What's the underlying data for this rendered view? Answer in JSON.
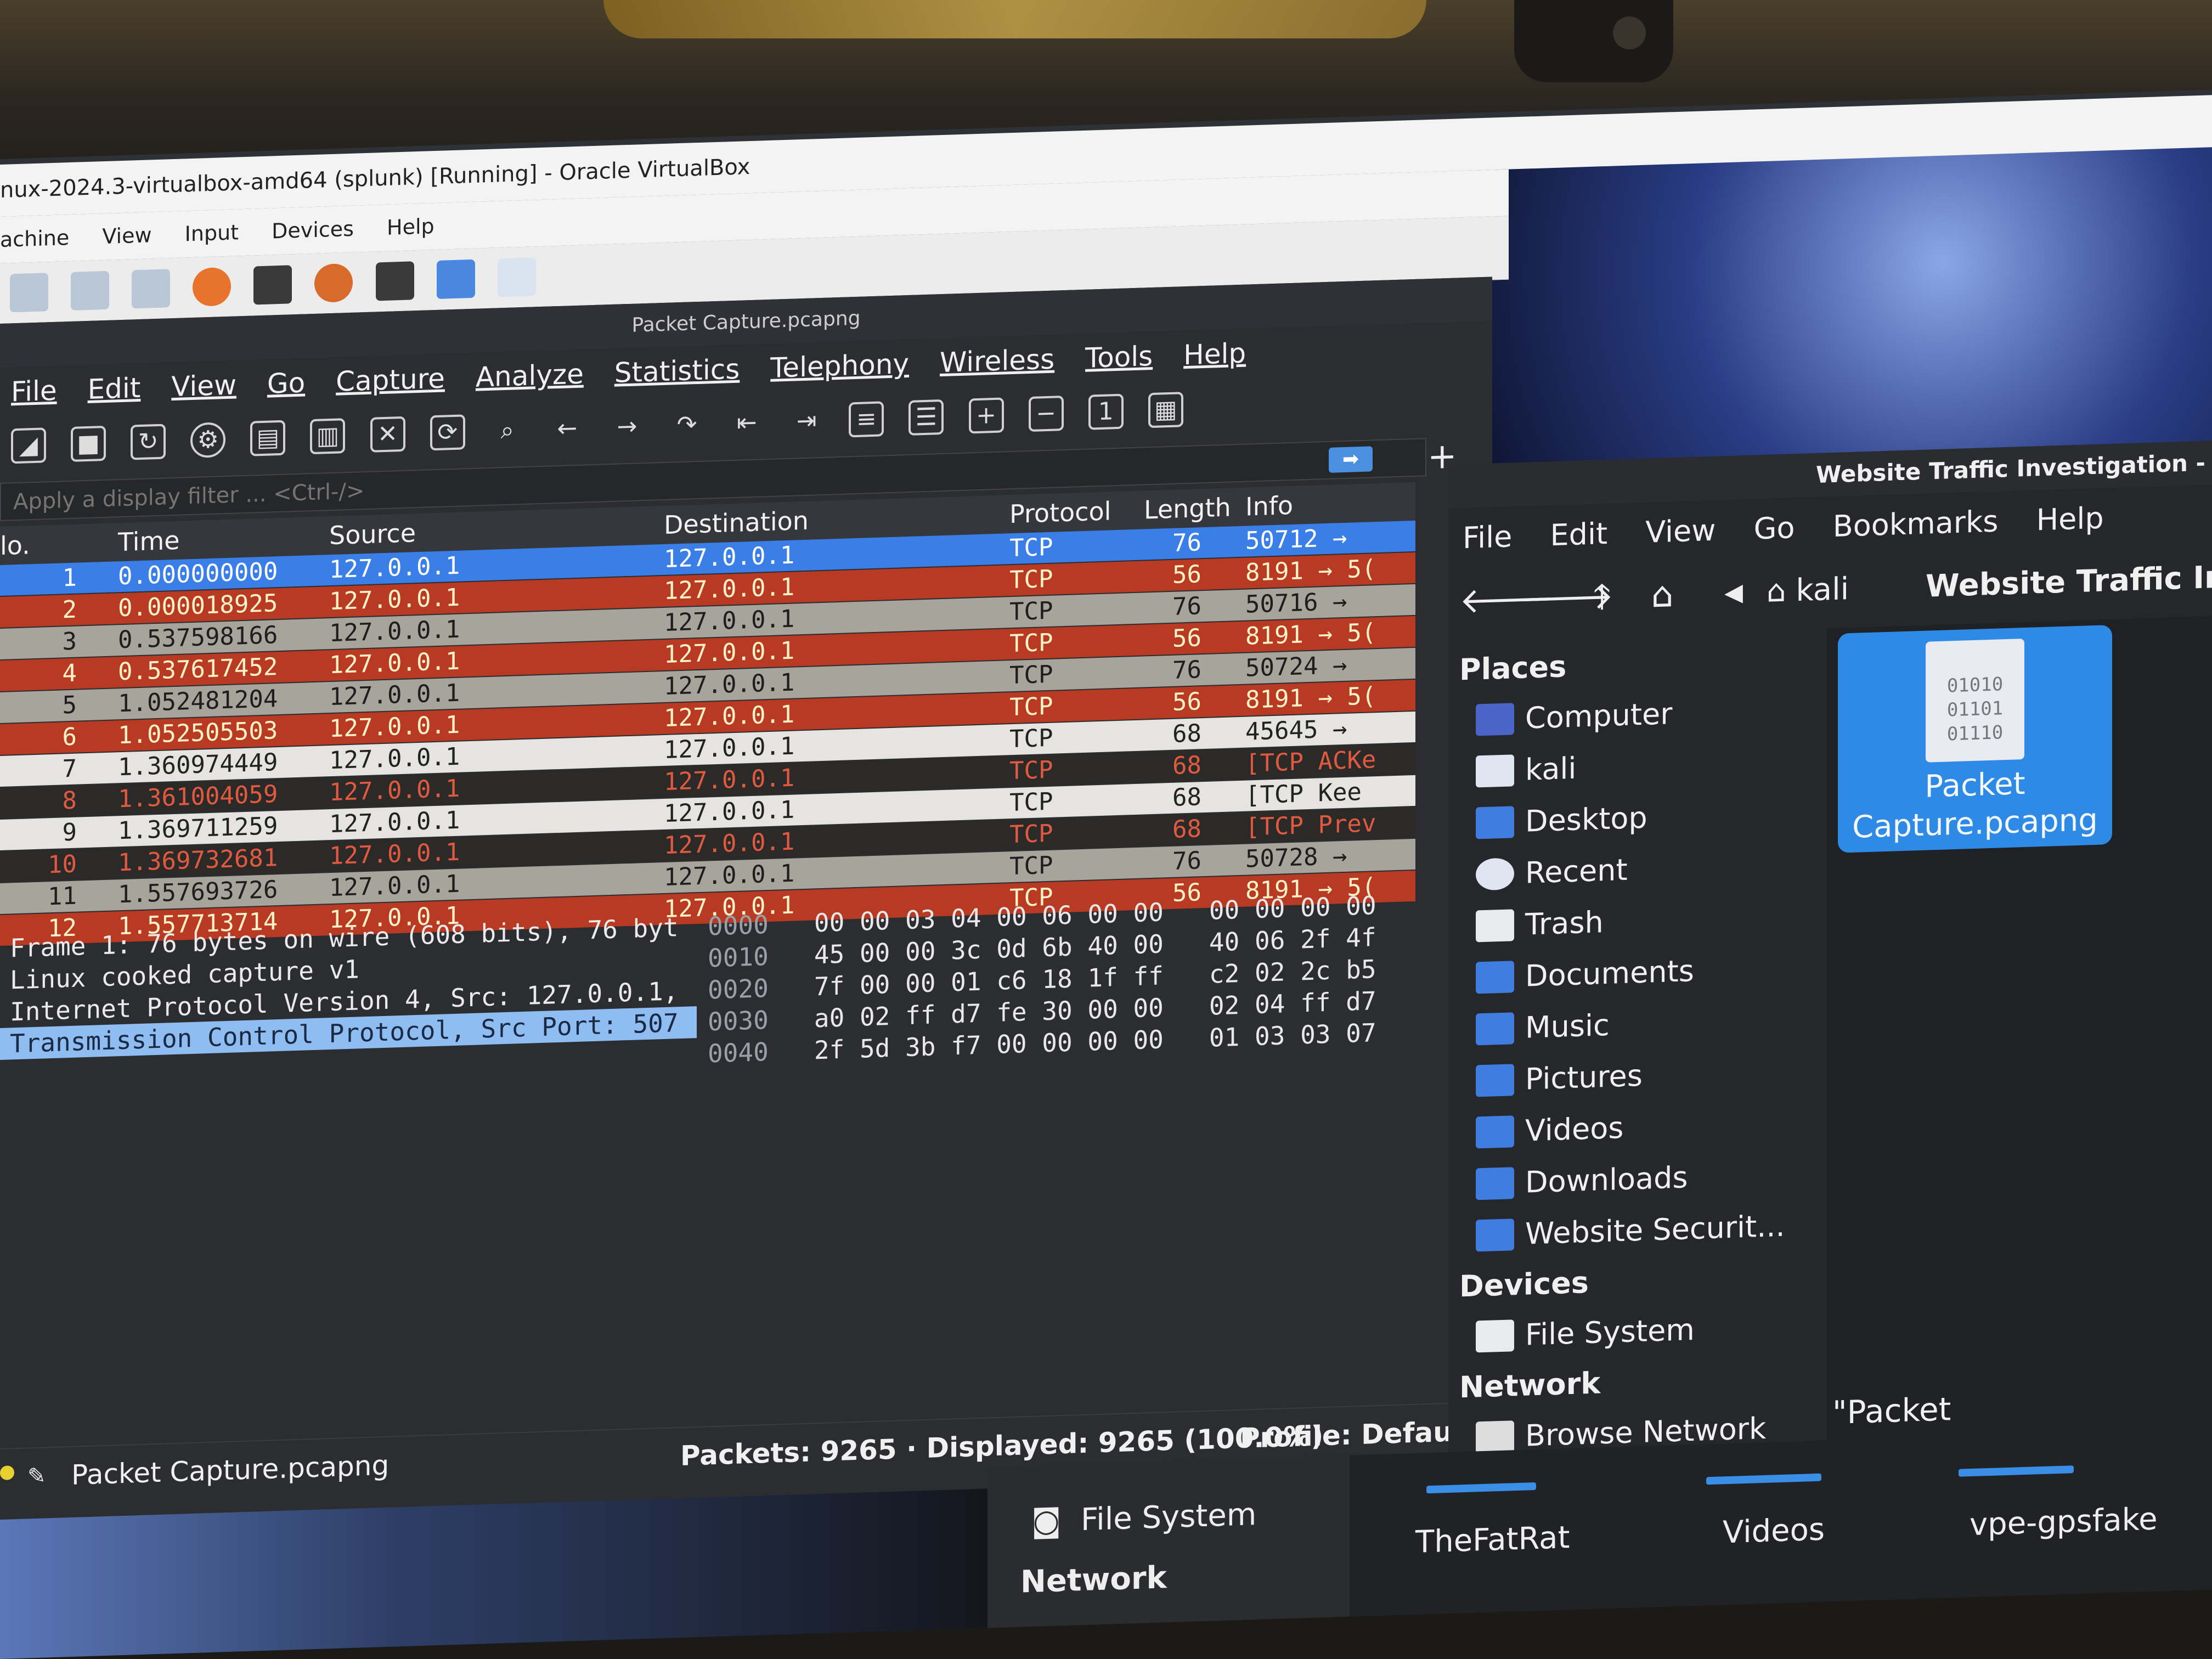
{
  "virtualbox": {
    "title": "nux-2024.3-virtualbox-amd64 (splunk) [Running] - Oracle VirtualBox",
    "menu": [
      "achine",
      "View",
      "Input",
      "Devices",
      "Help"
    ]
  },
  "wireshark": {
    "title": "Packet Capture.pcapng",
    "menu": [
      "File",
      "Edit",
      "View",
      "Go",
      "Capture",
      "Analyze",
      "Statistics",
      "Telephony",
      "Wireless",
      "Tools",
      "Help"
    ],
    "filter_placeholder": "Apply a display filter ... <Ctrl-/>",
    "columns": {
      "no": "lo.",
      "time": "Time",
      "source": "Source",
      "destination": "Destination",
      "protocol": "Protocol",
      "length": "Length",
      "info": "Info"
    },
    "packets": [
      {
        "no": "1",
        "time": "0.000000000",
        "source": "127.0.0.1",
        "destination": "127.0.0.1",
        "protocol": "TCP",
        "length": "76",
        "info": "50712 →",
        "style": "selected"
      },
      {
        "no": "2",
        "time": "0.000018925",
        "source": "127.0.0.1",
        "destination": "127.0.0.1",
        "protocol": "TCP",
        "length": "56",
        "info": "8191 → 5(",
        "style": "red"
      },
      {
        "no": "3",
        "time": "0.537598166",
        "source": "127.0.0.1",
        "destination": "127.0.0.1",
        "protocol": "TCP",
        "length": "76",
        "info": "50716 →",
        "style": "gray"
      },
      {
        "no": "4",
        "time": "0.537617452",
        "source": "127.0.0.1",
        "destination": "127.0.0.1",
        "protocol": "TCP",
        "length": "56",
        "info": "8191 → 5(",
        "style": "red"
      },
      {
        "no": "5",
        "time": "1.052481204",
        "source": "127.0.0.1",
        "destination": "127.0.0.1",
        "protocol": "TCP",
        "length": "76",
        "info": "50724 →",
        "style": "gray"
      },
      {
        "no": "6",
        "time": "1.052505503",
        "source": "127.0.0.1",
        "destination": "127.0.0.1",
        "protocol": "TCP",
        "length": "56",
        "info": "8191 → 5(",
        "style": "red"
      },
      {
        "no": "7",
        "time": "1.360974449",
        "source": "127.0.0.1",
        "destination": "127.0.0.1",
        "protocol": "TCP",
        "length": "68",
        "info": "45645 →",
        "style": "light"
      },
      {
        "no": "8",
        "time": "1.361004059",
        "source": "127.0.0.1",
        "destination": "127.0.0.1",
        "protocol": "TCP",
        "length": "68",
        "info": "[TCP ACKe",
        "style": "dark"
      },
      {
        "no": "9",
        "time": "1.369711259",
        "source": "127.0.0.1",
        "destination": "127.0.0.1",
        "protocol": "TCP",
        "length": "68",
        "info": "[TCP Kee",
        "style": "light"
      },
      {
        "no": "10",
        "time": "1.369732681",
        "source": "127.0.0.1",
        "destination": "127.0.0.1",
        "protocol": "TCP",
        "length": "68",
        "info": "[TCP Prev",
        "style": "dark"
      },
      {
        "no": "11",
        "time": "1.557693726",
        "source": "127.0.0.1",
        "destination": "127.0.0.1",
        "protocol": "TCP",
        "length": "76",
        "info": "50728 →",
        "style": "gray"
      },
      {
        "no": "12",
        "time": "1.557713714",
        "source": "127.0.0.1",
        "destination": "127.0.0.1",
        "protocol": "TCP",
        "length": "56",
        "info": "8191 → 5(",
        "style": "red"
      }
    ],
    "details": [
      {
        "text": "Frame 1: 76 bytes on wire (608 bits), 76 byt",
        "selected": false
      },
      {
        "text": "Linux cooked capture v1",
        "selected": false
      },
      {
        "text": "Internet Protocol Version 4, Src: 127.0.0.1,",
        "selected": false
      },
      {
        "text": "Transmission Control Protocol, Src Port: 507",
        "selected": true
      }
    ],
    "bytes": [
      {
        "offset": "0000",
        "hex": "00 00 03 04 00 06 00 00   00 00 00 00"
      },
      {
        "offset": "0010",
        "hex": "45 00 00 3c 0d 6b 40 00   40 06 2f 4f"
      },
      {
        "offset": "0020",
        "hex": "7f 00 00 01 c6 18 1f ff   c2 02 2c b5"
      },
      {
        "offset": "0030",
        "hex": "a0 02 ff d7 fe 30 00 00   02 04 ff d7"
      },
      {
        "offset": "0040",
        "hex": "2f 5d 3b f7 00 00 00 00   01 03 03 07"
      }
    ],
    "status": {
      "file": "Packet Capture.pcapng",
      "packets": "Packets: 9265 · Displayed: 9265 (100.0%)",
      "profile": "Profile: Default"
    },
    "row_colors": {
      "selected": {
        "bg": "#3a7ee8",
        "fg": "#ffffff"
      },
      "red": {
        "bg": "#b83a22",
        "fg": "#fff2c8"
      },
      "gray": {
        "bg": "#a7a49c",
        "fg": "#1e1e1e"
      },
      "light": {
        "bg": "#e6e4e0",
        "fg": "#222222"
      },
      "dark": {
        "bg": "#2c2a28",
        "fg": "#e05a40"
      }
    }
  },
  "file_manager": {
    "title": "Website Traffic Investigation -",
    "menu": [
      "File",
      "Edit",
      "View",
      "Go",
      "Bookmarks",
      "Help"
    ],
    "path": {
      "home": "kali",
      "current": "Website Traffic Inve"
    },
    "places_header": "Places",
    "places": [
      "Computer",
      "kali",
      "Desktop",
      "Recent",
      "Trash",
      "Documents",
      "Music",
      "Pictures",
      "Videos",
      "Downloads",
      "Website Securit..."
    ],
    "devices_header": "Devices",
    "devices": [
      "File System"
    ],
    "network_header": "Network",
    "network": [
      "Browse Network"
    ],
    "file": {
      "name": "Packet Capture.pcapng",
      "icon_text": "01010\n01101\n01110"
    },
    "status": "\"Packet Capture.pcapng\""
  },
  "taskbar": {
    "left_items": [
      "File System",
      "Network"
    ],
    "items": [
      "TheFatRat",
      "Videos",
      "vpe-gpsfake"
    ]
  }
}
